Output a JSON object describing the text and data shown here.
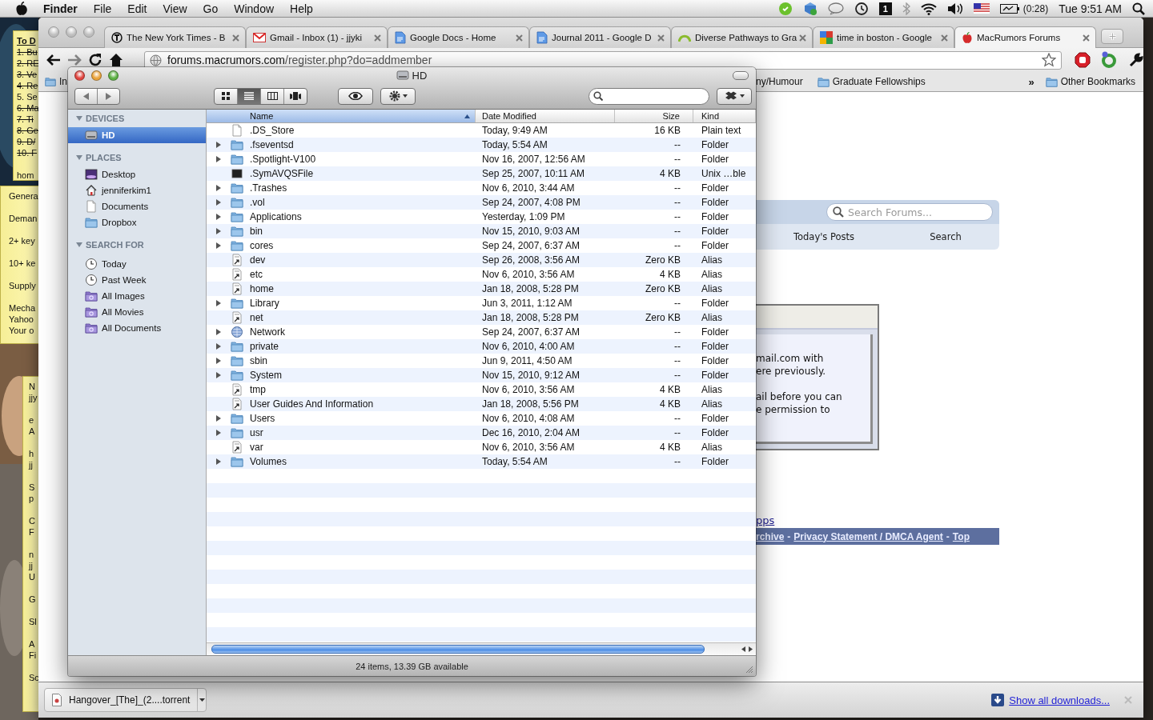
{
  "menubar": {
    "app": "Finder",
    "menus": [
      "File",
      "Edit",
      "View",
      "Go",
      "Window",
      "Help"
    ],
    "space_number": "1",
    "battery_time": "(0:28)",
    "clock": "Tue 9:51 AM"
  },
  "sticky_notes": [
    {
      "kind": "todo",
      "title": "To D",
      "items": [
        {
          "text": "1. Bu",
          "done": true
        },
        {
          "text": "2. RE",
          "done": true
        },
        {
          "text": "3. Ve",
          "done": true
        },
        {
          "text": "4. Re",
          "done": true
        },
        {
          "text": "5. Se",
          "done": false
        },
        {
          "text": "6. Ma",
          "done": true
        },
        {
          "text": "7. Ti",
          "done": true
        },
        {
          "text": "8. Ge",
          "done": true
        },
        {
          "text": "9. D/",
          "done": true
        },
        {
          "text": "10. F",
          "done": true
        }
      ],
      "footer": "hom"
    },
    {
      "kind": "text",
      "paragraphs": [
        [
          "Genera"
        ],
        [
          "Deman"
        ],
        [
          "2+ key"
        ],
        [
          "10+ ke"
        ],
        [
          "Supply"
        ],
        [
          "Mecha",
          "Yahoo",
          "Your o"
        ]
      ]
    },
    {
      "kind": "text",
      "paragraphs": [
        [
          "N",
          "jjy"
        ],
        [
          "e",
          "A"
        ],
        [
          "h",
          "jj"
        ],
        [
          "S",
          "p"
        ],
        [
          "C",
          "F"
        ],
        [
          "n",
          "jj",
          "U"
        ],
        [
          "G"
        ],
        [
          "Sl"
        ],
        [
          "A",
          "Fi"
        ],
        [
          "Sc"
        ]
      ]
    }
  ],
  "browser": {
    "tabs": [
      {
        "title": "The New York Times - B",
        "kind": "emblem",
        "selected": false
      },
      {
        "title": "Gmail - Inbox (1) - jjyki",
        "kind": "envelope",
        "selected": false
      },
      {
        "title": "Google Docs - Home",
        "kind": "document",
        "selected": false
      },
      {
        "title": "Journal 2011 - Google D",
        "kind": "document",
        "selected": false
      },
      {
        "title": "Diverse Pathways to Gra",
        "kind": "arc",
        "selected": false
      },
      {
        "title": "time in boston - Google",
        "kind": "squares",
        "selected": false
      },
      {
        "title": "MacRumors Forums",
        "kind": "apple",
        "selected": true
      }
    ],
    "address": {
      "host": "forums.macrumors.com",
      "path": "/register.php?do=addmember"
    },
    "bookmarks_left": [
      {
        "label": "In",
        "folder": true
      }
    ],
    "bookmarks_right": [
      {
        "label": "ny/Humour",
        "folder": false
      },
      {
        "label": "Graduate Fellowships",
        "folder": true
      }
    ],
    "overflow": "»",
    "other_bookmarks": "Other Bookmarks",
    "page": {
      "search_placeholder": "Search Forums...",
      "nav_links": [
        "Today's Posts",
        "Search"
      ],
      "notice": [
        [
          "mail.com with",
          "ere previously."
        ],
        [
          "ail before you can",
          "e permission to"
        ]
      ],
      "apps_link": "pps",
      "footer_links": [
        "rchive",
        "Privacy Statement / DMCA Agent",
        "Top"
      ],
      "footer_separator": "-"
    },
    "download": {
      "file": "Hangover_[The]_(2....torrent",
      "show_all": "Show all downloads..."
    }
  },
  "finder": {
    "title": "HD",
    "view_modes": [
      {
        "kind": "icons",
        "selected": false
      },
      {
        "kind": "list",
        "selected": true
      },
      {
        "kind": "columns",
        "selected": false
      },
      {
        "kind": "coverflow",
        "selected": false
      }
    ],
    "sidebar": [
      {
        "heading": "DEVICES",
        "items": [
          {
            "label": "HD",
            "kind": "drive",
            "selected": true
          }
        ]
      },
      {
        "heading": "PLACES",
        "items": [
          {
            "label": "Desktop",
            "kind": "desktop",
            "selected": false
          },
          {
            "label": "jenniferkim1",
            "kind": "home",
            "selected": false
          },
          {
            "label": "Documents",
            "kind": "document",
            "selected": false
          },
          {
            "label": "Dropbox",
            "kind": "folder",
            "selected": false
          }
        ]
      },
      {
        "heading": "SEARCH FOR",
        "items": [
          {
            "label": "Today",
            "kind": "clock",
            "selected": false
          },
          {
            "label": "Past Week",
            "kind": "clock",
            "selected": false
          },
          {
            "label": "All Images",
            "kind": "smart",
            "selected": false
          },
          {
            "label": "All Movies",
            "kind": "smart",
            "selected": false
          },
          {
            "label": "All Documents",
            "kind": "smart",
            "selected": false
          }
        ]
      }
    ],
    "columns": [
      {
        "label": "Name",
        "sorted": true
      },
      {
        "label": "Date Modified",
        "sorted": false
      },
      {
        "label": "Size",
        "sorted": false
      },
      {
        "label": "Kind",
        "sorted": false
      }
    ],
    "rows": [
      {
        "name": ".DS_Store",
        "date": "Today, 9:49 AM",
        "size": "16 KB",
        "file_kind": "Plain text",
        "kind": "document",
        "expandable": false
      },
      {
        "name": ".fseventsd",
        "date": "Today, 5:54 AM",
        "size": "--",
        "file_kind": "Folder",
        "kind": "folder",
        "expandable": true
      },
      {
        "name": ".Spotlight-V100",
        "date": "Nov 16, 2007, 12:56 AM",
        "size": "--",
        "file_kind": "Folder",
        "kind": "folder",
        "expandable": true
      },
      {
        "name": ".SymAVQSFile",
        "date": "Sep 25, 2007, 10:11 AM",
        "size": "4 KB",
        "file_kind": "Unix …ble",
        "kind": "black",
        "expandable": false
      },
      {
        "name": ".Trashes",
        "date": "Nov 6, 2010, 3:44 AM",
        "size": "--",
        "file_kind": "Folder",
        "kind": "folder",
        "expandable": true
      },
      {
        "name": ".vol",
        "date": "Sep 24, 2007, 4:08 PM",
        "size": "--",
        "file_kind": "Folder",
        "kind": "folder",
        "expandable": true
      },
      {
        "name": "Applications",
        "date": "Yesterday, 1:09 PM",
        "size": "--",
        "file_kind": "Folder",
        "kind": "folder",
        "expandable": true
      },
      {
        "name": "bin",
        "date": "Nov 15, 2010, 9:03 AM",
        "size": "--",
        "file_kind": "Folder",
        "kind": "folder",
        "expandable": true
      },
      {
        "name": "cores",
        "date": "Sep 24, 2007, 6:37 AM",
        "size": "--",
        "file_kind": "Folder",
        "kind": "folder",
        "expandable": true
      },
      {
        "name": "dev",
        "date": "Sep 26, 2008, 3:56 AM",
        "size": "Zero KB",
        "file_kind": "Alias",
        "kind": "alias",
        "expandable": false
      },
      {
        "name": "etc",
        "date": "Nov 6, 2010, 3:56 AM",
        "size": "4 KB",
        "file_kind": "Alias",
        "kind": "alias",
        "expandable": false
      },
      {
        "name": "home",
        "date": "Jan 18, 2008, 5:28 PM",
        "size": "Zero KB",
        "file_kind": "Alias",
        "kind": "alias",
        "expandable": false
      },
      {
        "name": "Library",
        "date": "Jun 3, 2011, 1:12 AM",
        "size": "--",
        "file_kind": "Folder",
        "kind": "folder",
        "expandable": true
      },
      {
        "name": "net",
        "date": "Jan 18, 2008, 5:28 PM",
        "size": "Zero KB",
        "file_kind": "Alias",
        "kind": "alias",
        "expandable": false
      },
      {
        "name": "Network",
        "date": "Sep 24, 2007, 6:37 AM",
        "size": "--",
        "file_kind": "Folder",
        "kind": "globe",
        "expandable": true
      },
      {
        "name": "private",
        "date": "Nov 6, 2010, 4:00 AM",
        "size": "--",
        "file_kind": "Folder",
        "kind": "folder",
        "expandable": true
      },
      {
        "name": "sbin",
        "date": "Jun 9, 2011, 4:50 AM",
        "size": "--",
        "file_kind": "Folder",
        "kind": "folder",
        "expandable": true
      },
      {
        "name": "System",
        "date": "Nov 15, 2010, 9:12 AM",
        "size": "--",
        "file_kind": "Folder",
        "kind": "folder",
        "expandable": true
      },
      {
        "name": "tmp",
        "date": "Nov 6, 2010, 3:56 AM",
        "size": "4 KB",
        "file_kind": "Alias",
        "kind": "alias",
        "expandable": false
      },
      {
        "name": "User Guides And Information",
        "date": "Jan 18, 2008, 5:56 PM",
        "size": "4 KB",
        "file_kind": "Alias",
        "kind": "alias",
        "expandable": false
      },
      {
        "name": "Users",
        "date": "Nov 6, 2010, 4:08 AM",
        "size": "--",
        "file_kind": "Folder",
        "kind": "folder",
        "expandable": true
      },
      {
        "name": "usr",
        "date": "Dec 16, 2010, 2:04 AM",
        "size": "--",
        "file_kind": "Folder",
        "kind": "folder",
        "expandable": true
      },
      {
        "name": "var",
        "date": "Nov 6, 2010, 3:56 AM",
        "size": "4 KB",
        "file_kind": "Alias",
        "kind": "alias",
        "expandable": false
      },
      {
        "name": "Volumes",
        "date": "Today, 5:54 AM",
        "size": "--",
        "file_kind": "Folder",
        "kind": "folder",
        "expandable": true
      }
    ],
    "status": "24 items, 13.39 GB available"
  }
}
